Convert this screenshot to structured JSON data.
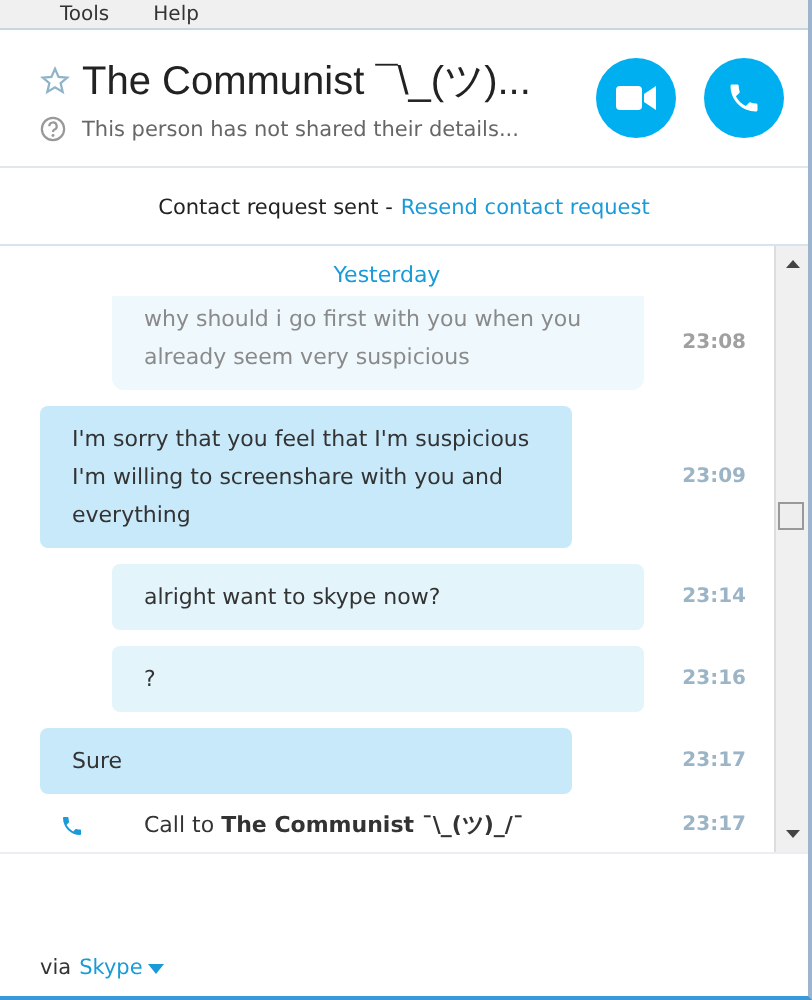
{
  "menu": [
    "Tools",
    "Help"
  ],
  "header": {
    "title": "The Communist ¯\\_(ツ)...",
    "subtitle": "This person has not shared their details...",
    "starred": false
  },
  "contact_request": {
    "text": "Contact request sent -",
    "link": "Resend contact request"
  },
  "date_separator": "Yesterday",
  "messages": [
    {
      "kind": "sent",
      "faded": true,
      "text": "why should i go first with you when you already seem very suspicious",
      "time": "23:08"
    },
    {
      "kind": "received",
      "faded": false,
      "text": "I'm sorry that you feel that I'm suspicious I'm willing to screenshare with you and everything",
      "time": "23:09"
    },
    {
      "kind": "sent",
      "faded": false,
      "text": "alright want to skype now?",
      "time": "23:14"
    },
    {
      "kind": "sent",
      "faded": false,
      "text": "?",
      "time": "23:16"
    },
    {
      "kind": "received",
      "faded": false,
      "text": "Sure",
      "time": "23:17"
    },
    {
      "kind": "call",
      "faded": false,
      "text": "Call to **The Communist ¯\\_(ツ)_/¯**",
      "time": "23:17"
    }
  ],
  "footer": {
    "prefix": "via",
    "service": "Skype"
  }
}
